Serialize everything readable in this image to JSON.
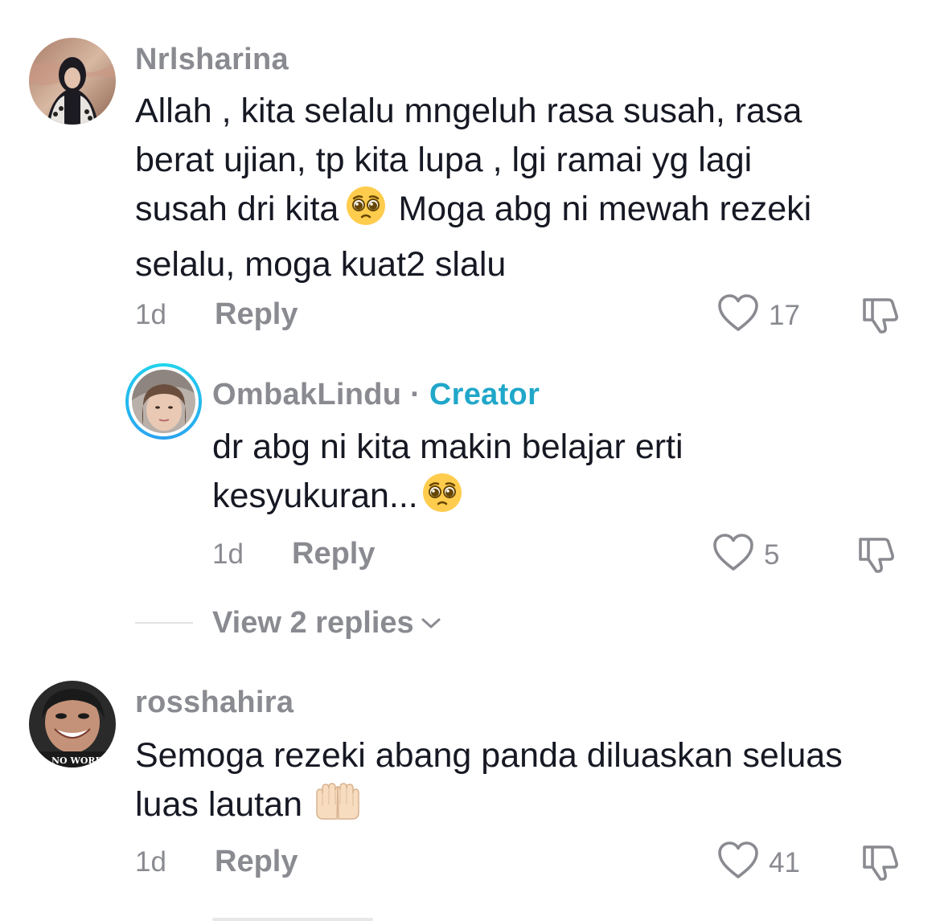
{
  "comments": [
    {
      "username": "Nrlsharina",
      "text_parts": [
        "Allah , kita selalu mngeluh rasa susah, rasa",
        "berat ujian, tp kita lupa , lgi ramai yg lagi",
        "susah dri kita",
        "Moga abg ni mewah rezeki",
        "selalu, moga kuat2 slalu"
      ],
      "emoji_icon": "pleading-face",
      "time": "1d",
      "reply_label": "Reply",
      "likes": "17"
    },
    {
      "username": "OmbakLindu",
      "separator": " · ",
      "badge": "Creator",
      "text_parts": [
        "dr abg ni kita makin belajar erti",
        "kesyukuran..."
      ],
      "emoji_icon": "pleading-face",
      "time": "1d",
      "reply_label": "Reply",
      "likes": "5"
    },
    {
      "username": "rosshahira",
      "avatar_text": "NO WORRI",
      "text_parts": [
        "Semoga rezeki abang panda diluaskan seluas",
        "luas lautan"
      ],
      "emoji_icon": "palms-up-together",
      "time": "1d",
      "reply_label": "Reply",
      "likes": "41"
    }
  ],
  "view_replies_label": "View 2 replies",
  "colors": {
    "text": "#161823",
    "muted": "#8a8b91",
    "creator_accent": "#20a7c9",
    "emoji_yellow": "#ffcc4d"
  }
}
